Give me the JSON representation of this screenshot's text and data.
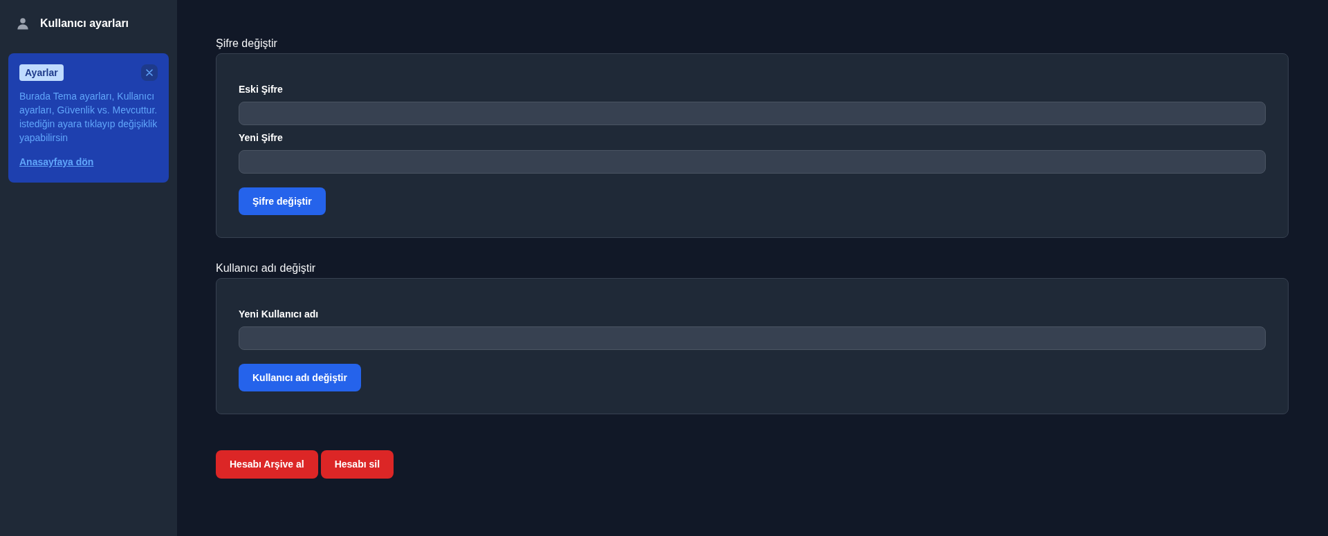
{
  "sidebar": {
    "title": "Kullanıcı ayarları",
    "alert": {
      "badge": "Ayarlar",
      "message": "Burada Tema ayarları, Kullanıcı ayarları, Güvenlik vs. Mevcuttur. istediğin ayara tıklayıp değişiklik yapabilirsin",
      "link": "Anasayfaya dön"
    }
  },
  "sections": [
    {
      "title": "Şifre değiştir",
      "fields": [
        {
          "label": "Eski Şifre"
        },
        {
          "label": "Yeni Şifre"
        }
      ],
      "button": "Şifre değiştir"
    },
    {
      "title": "Kullanıcı adı değiştir",
      "fields": [
        {
          "label": "Yeni Kullanıcı adı"
        }
      ],
      "button": "Kullanıcı adı değiştir"
    }
  ],
  "danger_buttons": [
    "Hesabı Arşive al",
    "Hesabı sil"
  ]
}
